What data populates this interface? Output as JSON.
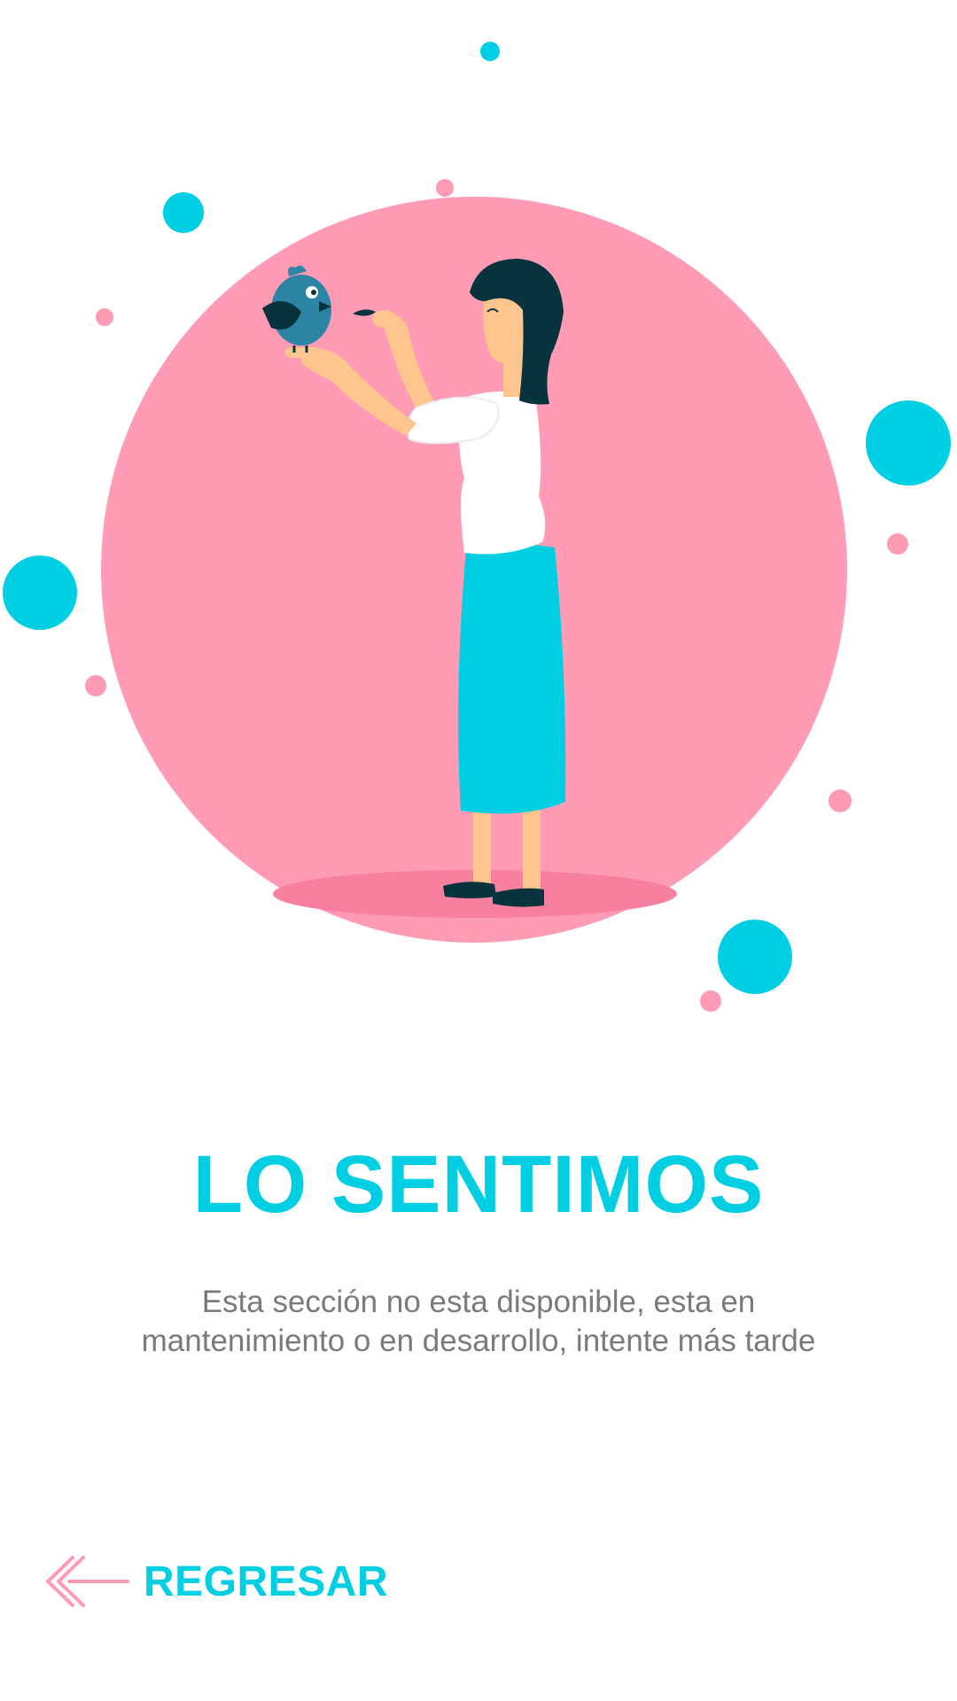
{
  "page": {
    "title": "LO SENTIMOS",
    "message_lines": [
      "Esta sección no esta disponible, esta en",
      "mantenimiento o en desarrollo, intente más tarde"
    ],
    "back_label": "REGRESAR"
  },
  "icons": {
    "back": "double-chevron-left-arrow-icon",
    "illustration": "woman-feeding-bird-illustration"
  },
  "colors": {
    "accent": "#00cfe3",
    "pink": "#ff9bb5",
    "pink_dark": "#f77fa0",
    "text_gray": "#7a7a7a",
    "background": "#ffffff"
  }
}
